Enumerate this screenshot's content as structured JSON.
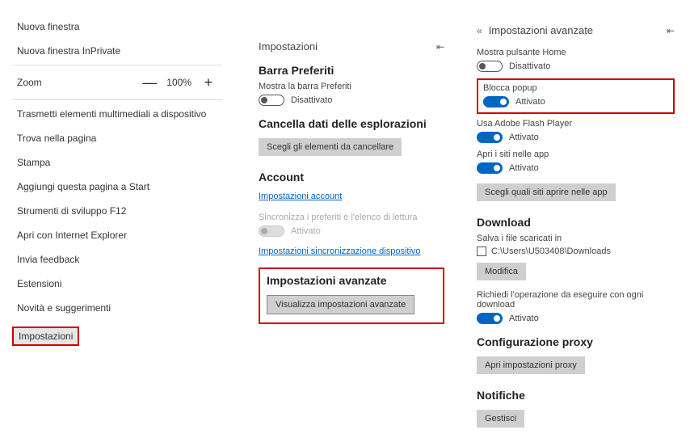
{
  "leftMenu": {
    "newWindow": "Nuova finestra",
    "newInPrivate": "Nuova finestra InPrivate",
    "zoomLabel": "Zoom",
    "zoomMinus": "—",
    "zoomValue": "100%",
    "zoomPlus": "+",
    "cast": "Trasmetti elementi multimediali a dispositivo",
    "findOnPage": "Trova nella pagina",
    "print": "Stampa",
    "pinToStart": "Aggiungi questa pagina a Start",
    "devTools": "Strumenti di sviluppo F12",
    "openWithIE": "Apri con Internet Explorer",
    "feedback": "Invia feedback",
    "extensions": "Estensioni",
    "whatsNew": "Novità e suggerimenti",
    "settings": "Impostazioni"
  },
  "midPanel": {
    "title": "Impostazioni",
    "favBar": "Barra Preferiti",
    "showFavBar": "Mostra la barra Preferiti",
    "offText": "Disattivato",
    "onText": "Attivato",
    "clearData": "Cancella dati delle esplorazioni",
    "clearDataBtn": "Scegli gli elementi da cancellare",
    "account": "Account",
    "accountSettings": "Impostazioni account",
    "syncLabel": "Sincronizza i preferiti e l'elenco di lettura",
    "syncState": "Attivato",
    "syncSettings": "Impostazioni sincronizzazione dispositivo",
    "advanced": "Impostazioni avanzate",
    "advancedBtn": "Visualizza impostazioni avanzate"
  },
  "rightPanel": {
    "title": "Impostazioni avanzate",
    "showHome": "Mostra pulsante Home",
    "offText": "Disattivato",
    "onText": "Attivato",
    "blockPopup": "Blocca popup",
    "flash": "Usa Adobe Flash Player",
    "openInApps": "Apri i siti nelle app",
    "chooseSitesBtn": "Scegli quali siti aprire nelle app",
    "download": "Download",
    "saveFilesIn": "Salva i file scaricati in",
    "downloadPath": "C:\\Users\\U503408\\Downloads",
    "modifyBtn": "Modifica",
    "askEachDownload": "Richiedi l'operazione da eseguire con ogni download",
    "proxyConfig": "Configurazione proxy",
    "proxyBtn": "Apri impostazioni proxy",
    "notifications": "Notifiche",
    "manageBtn": "Gestisci"
  }
}
